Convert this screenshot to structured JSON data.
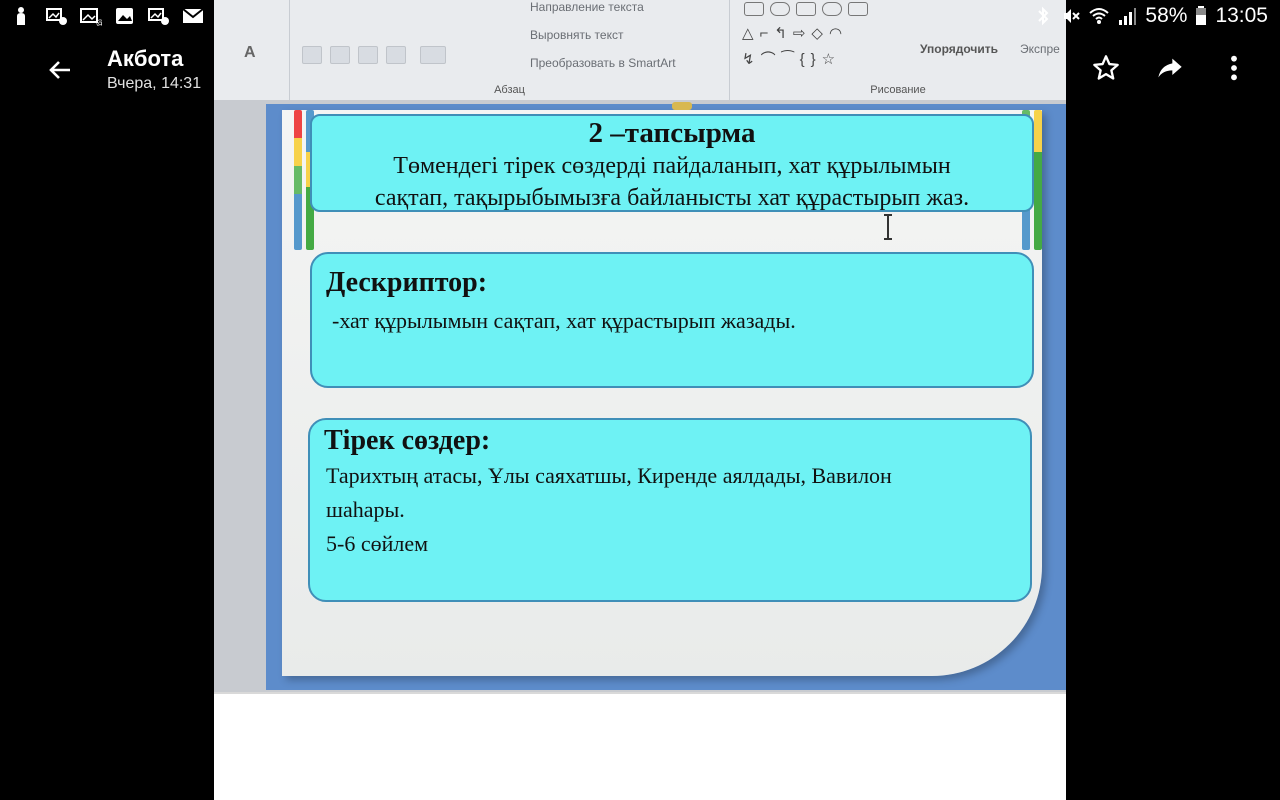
{
  "status_bar": {
    "battery": "58%",
    "time": "13:05",
    "icons_left": [
      "silhouette-icon",
      "image-notification-icon",
      "gallery-icon",
      "image-notification-icon",
      "mail-icon"
    ],
    "icons_right": [
      "bluetooth-icon",
      "mute-icon",
      "wifi-icon",
      "signal-icon",
      "battery-icon"
    ]
  },
  "app_bar": {
    "title": "Акбота",
    "subtitle": "Вчера, 14:31",
    "actions": [
      "star-icon",
      "share-icon",
      "more-vert-icon"
    ]
  },
  "photo": {
    "ribbon": {
      "group_paragraph": "Абзац",
      "group_drawing": "Рисование",
      "btn_text_direction": "Направление текста",
      "btn_align_text": "Выровнять текст",
      "btn_smartart": "Преобразовать в SmartArt",
      "btn_arrange": "Упорядочить",
      "btn_express": "Экспре"
    },
    "slide": {
      "card1": {
        "title": "2 –тапсырма",
        "line1": "Төмендегі тірек сөздерді пайдаланып, хат құрылымын",
        "line2": "сақтап, тақырыбымызға байланысты хат құрастырып жаз."
      },
      "card2": {
        "heading": "Дескриптор:",
        "body": "-хат құрылымын сақтап, хат құрастырып жазады."
      },
      "card3": {
        "heading": "Тірек сөздер:",
        "line1": "Тарихтың атасы, Ұлы саяхатшы, Киренде аялдады, Вавилон",
        "line2": "шаһары.",
        "line3": "5-6 сөйлем"
      }
    }
  }
}
